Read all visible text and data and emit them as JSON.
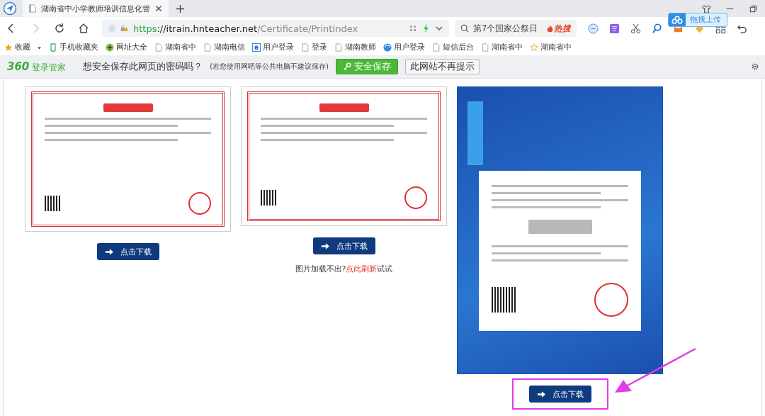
{
  "tab": {
    "title": "湖南省中小学教师培训信息化管"
  },
  "address": {
    "scheme": "https",
    "host": "://itrain.hnteacher.net",
    "path": "/Certificate/PrintIndex"
  },
  "search": {
    "value": "第7个国家公祭日",
    "hot": "热搜"
  },
  "upload_tip": "拖拽上传",
  "bookmarks": [
    {
      "kind": "star",
      "label": "收藏",
      "dropdown": true
    },
    {
      "kind": "phone",
      "label": "手机收藏夹",
      "dropdown": false
    },
    {
      "kind": "plus",
      "label": "网址大全",
      "dropdown": false
    },
    {
      "kind": "page",
      "label": "湖南省中",
      "dropdown": false
    },
    {
      "kind": "page",
      "label": "湖南电信",
      "dropdown": false
    },
    {
      "kind": "ie",
      "label": "用户登录",
      "dropdown": false
    },
    {
      "kind": "page",
      "label": "登录",
      "dropdown": false
    },
    {
      "kind": "page",
      "label": "湖南教师",
      "dropdown": false
    },
    {
      "kind": "globe",
      "label": "用户登录",
      "dropdown": false
    },
    {
      "kind": "page",
      "label": "短信后台",
      "dropdown": false
    },
    {
      "kind": "page",
      "label": "湖南省中",
      "dropdown": false
    },
    {
      "kind": "outline-star",
      "label": "湖南省中",
      "dropdown": false
    }
  ],
  "password_bar": {
    "brand": "360",
    "brand_name": "登录管家",
    "question": "想安全保存此网页的密码吗？",
    "note": "(若您使用网吧等公共电脑不建议保存)",
    "save_button": "安全保存",
    "never_button": "此网站不再提示"
  },
  "certificates": [
    {
      "kind": "red",
      "button": "点击下载",
      "highlighted": false
    },
    {
      "kind": "red-wide",
      "button": "点击下载",
      "highlighted": false,
      "note": {
        "before": "图片加载不出?",
        "link": "点此刷新",
        "after": "试试"
      }
    },
    {
      "kind": "blue",
      "button": "点击下载",
      "highlighted": true
    }
  ]
}
